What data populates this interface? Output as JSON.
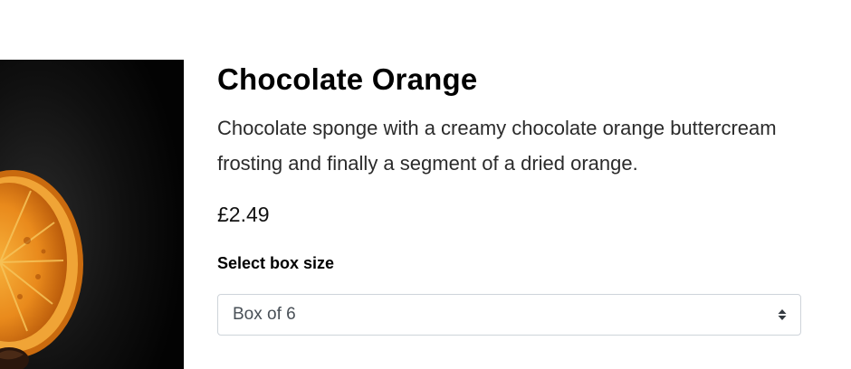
{
  "product": {
    "title": "Chocolate Orange",
    "description": "Chocolate sponge with a creamy chocolate orange buttercream frosting and finally a segment of a dried orange.",
    "price": "£2.49"
  },
  "box_size": {
    "label": "Select box size",
    "selected": "Box of 6"
  },
  "image": {
    "subject": "dried orange slice on chocolate cupcake",
    "background_color": "#050505",
    "orange_color": "#e8891a"
  }
}
